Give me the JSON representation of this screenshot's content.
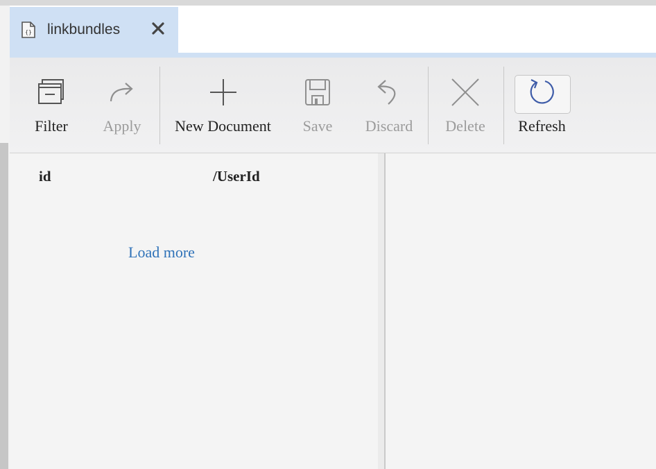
{
  "tab": {
    "label": "linkbundles",
    "icon": "json-document-icon",
    "close_icon": "close-x-icon"
  },
  "toolbar": {
    "filter": {
      "label": "Filter",
      "icon": "filter-window-icon",
      "enabled": true
    },
    "apply": {
      "label": "Apply",
      "icon": "redo-arrow-icon",
      "enabled": false
    },
    "new_document": {
      "label": "New Document",
      "icon": "plus-icon",
      "enabled": true
    },
    "save": {
      "label": "Save",
      "icon": "floppy-disk-icon",
      "enabled": false
    },
    "discard": {
      "label": "Discard",
      "icon": "undo-arrow-icon",
      "enabled": false
    },
    "delete": {
      "label": "Delete",
      "icon": "x-icon",
      "enabled": false
    },
    "refresh": {
      "label": "Refresh",
      "icon": "refresh-circle-icon",
      "enabled": true
    }
  },
  "documents": {
    "columns": [
      "id",
      "/UserId"
    ],
    "rows": [],
    "load_more": "Load more"
  },
  "colors": {
    "tab_active": "#cfe0f4",
    "toolbar_bg": "#eeeeef",
    "link": "#2f72b8",
    "refresh_icon": "#3e5ca8",
    "disabled_text": "#9b9b9b"
  }
}
